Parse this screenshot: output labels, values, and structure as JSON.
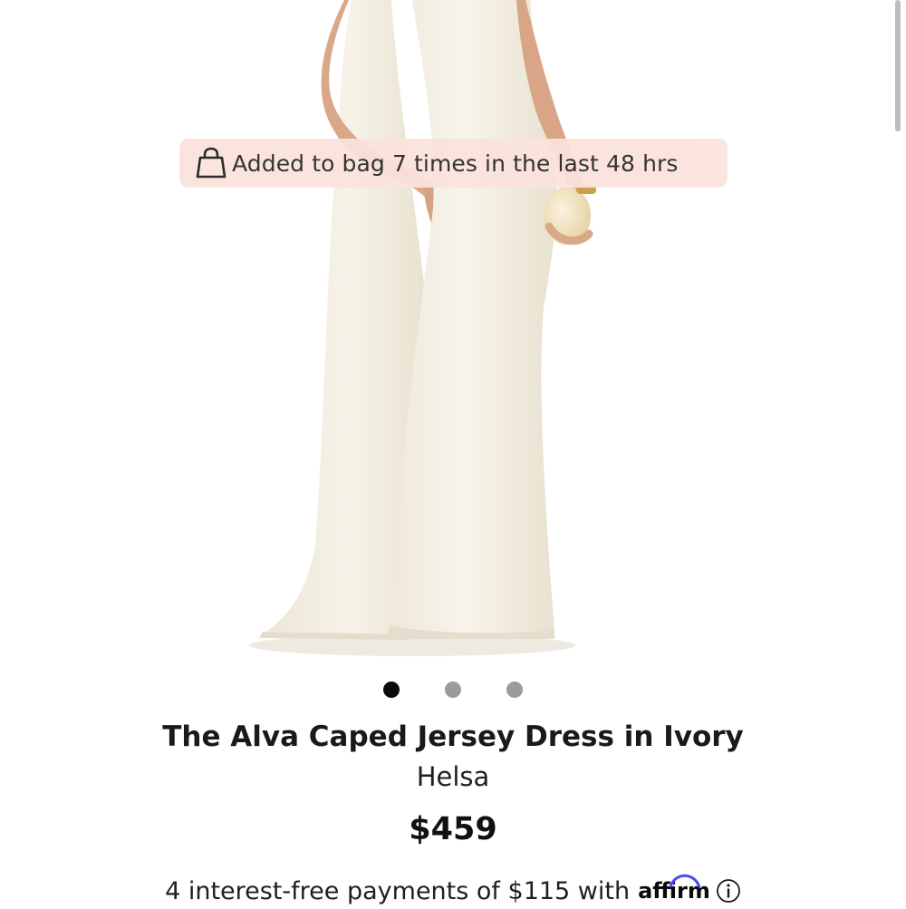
{
  "notice": {
    "text": "Added to bag 7 times in the last 48 hrs",
    "icon": "shopping-bag-icon",
    "background": "#fbe3dc"
  },
  "gallery": {
    "image": "model-wearing-ivory-caped-gown",
    "slide_count": 3,
    "active_index": 0
  },
  "product": {
    "title": "The Alva Caped Jersey Dress in Ivory",
    "brand": "Helsa",
    "price": "$459"
  },
  "payments": {
    "text": "4 interest-free payments of $115 with",
    "provider": "affirm",
    "info_icon": "info-circle-icon"
  }
}
